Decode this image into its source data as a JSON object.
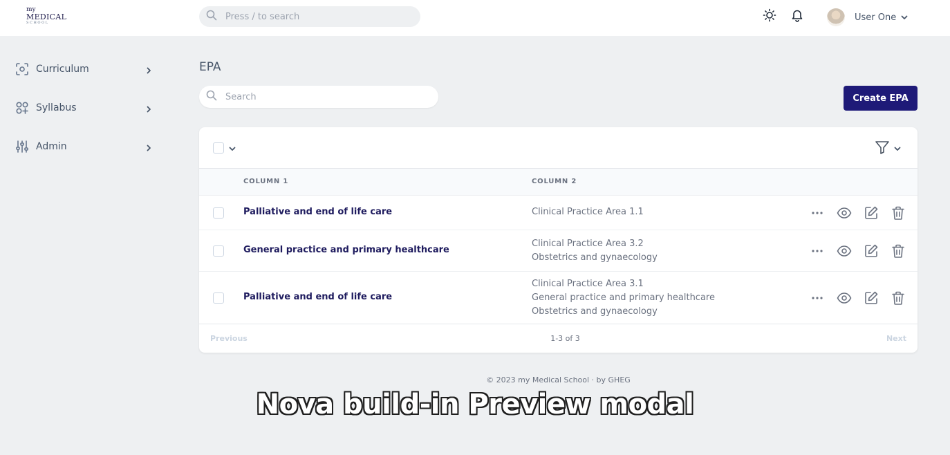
{
  "logo": {
    "line1": "my",
    "line2": "MEDICAL",
    "line3": "SCHOOL"
  },
  "header": {
    "search_placeholder": "Press / to search",
    "user_name": "User One",
    "icons": {
      "theme": "sun-icon",
      "notifications": "bell-icon",
      "user_menu": "chevron-down-icon"
    }
  },
  "sidebar": {
    "items": [
      {
        "label": "Curriculum",
        "icon": "curriculum-icon"
      },
      {
        "label": "Syllabus",
        "icon": "grid-plus-icon"
      },
      {
        "label": "Admin",
        "icon": "sliders-icon"
      }
    ]
  },
  "main": {
    "title": "EPA",
    "search_placeholder": "Search",
    "create_label": "Create EPA",
    "columns": [
      "COLUMN 1",
      "COLUMN 2"
    ],
    "rows": [
      {
        "name": "Palliative and end of life care",
        "areas": [
          "Clinical Practice Area 1.1"
        ]
      },
      {
        "name": "General practice and primary healthcare",
        "areas": [
          "Clinical Practice Area 3.2",
          "Obstetrics and gynaecology"
        ]
      },
      {
        "name": "Palliative and end of life care",
        "areas": [
          "Clinical Practice Area 3.1",
          "General practice and primary healthcare",
          "Obstetrics and gynaecology"
        ]
      }
    ],
    "pagination": {
      "previous": "Previous",
      "info": "1-3 of 3",
      "next": "Next"
    }
  },
  "footer": {
    "text": "© 2023 my Medical School · by GHEG"
  },
  "caption": {
    "text": "Nova build-in Preview modal"
  },
  "colors": {
    "primary": "#1e1a78",
    "row_title": "#1e1b5e",
    "background": "#eef0f2"
  }
}
